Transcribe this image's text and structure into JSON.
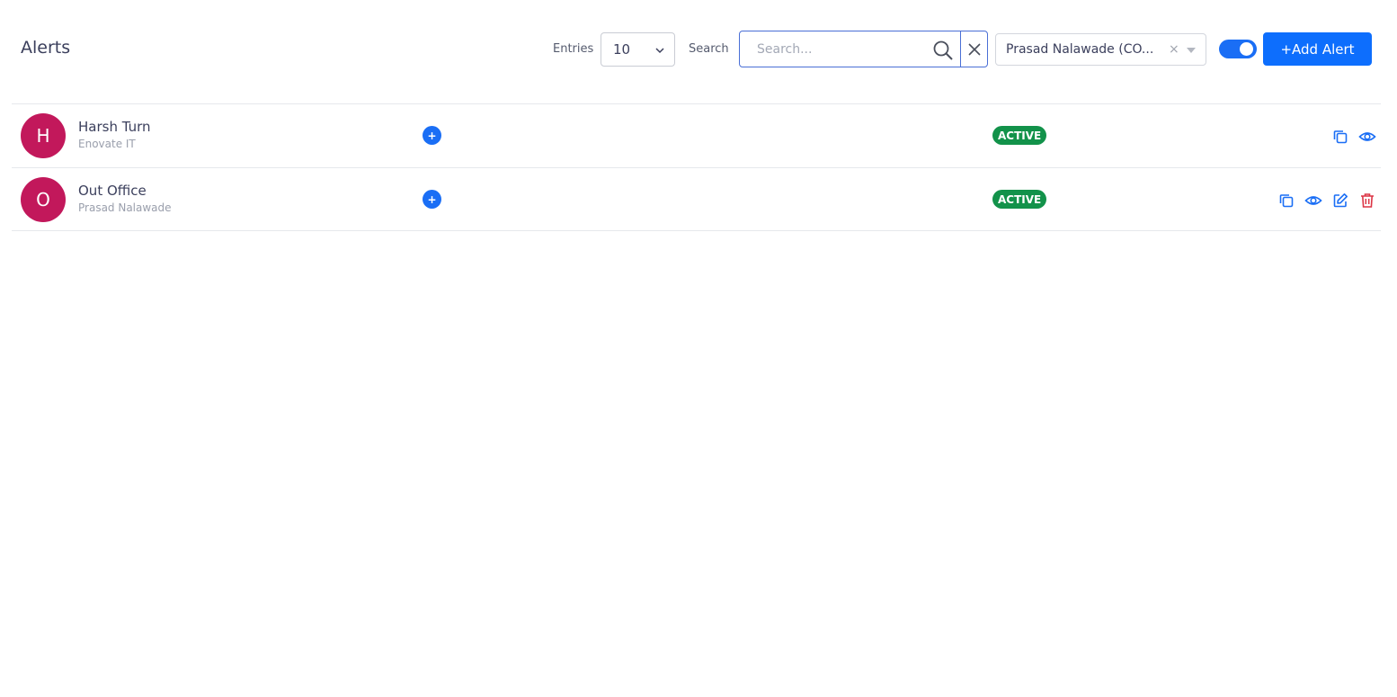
{
  "header": {
    "title": "Alerts",
    "entries_label": "Entries",
    "entries_value": "10",
    "search_label": "Search",
    "search_placeholder": "Search...",
    "user_filter_value": "Prasad Nalawade (CO...",
    "user_filter_clear": "×",
    "toggle_on": true,
    "add_button_label": "+Add Alert"
  },
  "colors": {
    "primary": "#0d6efd",
    "avatar": "#c2185b",
    "status_active": "#12924a",
    "delete": "#dc3545"
  },
  "alerts": [
    {
      "initial": "H",
      "title": "Harsh Turn",
      "subtitle": "Enovate IT",
      "add_icon": "+",
      "status": "ACTIVE",
      "actions": [
        "copy-icon",
        "eye-icon"
      ]
    },
    {
      "initial": "O",
      "title": "Out Office",
      "subtitle": "Prasad Nalawade",
      "add_icon": "+",
      "status": "ACTIVE",
      "actions": [
        "copy-icon",
        "eye-icon",
        "edit-icon",
        "trash-icon"
      ]
    }
  ]
}
